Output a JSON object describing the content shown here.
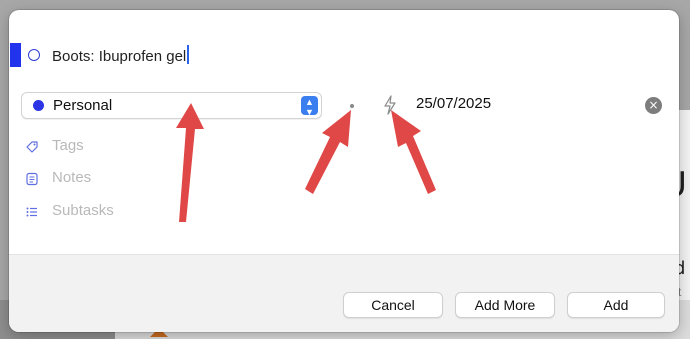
{
  "reminder": {
    "title": "Boots: Ibuprofen gel",
    "list_name": "Personal",
    "list_color": "#2b35e6",
    "due_date": "25/07/2025"
  },
  "fields": {
    "tags_placeholder": "Tags",
    "notes_placeholder": "Notes",
    "subtasks_placeholder": "Subtasks"
  },
  "buttons": {
    "cancel": "Cancel",
    "add_more": "Add More",
    "add": "Add"
  },
  "icons": {
    "status": "circle-check-icon",
    "list_stepper": "chevron-up-down-icon",
    "priority": "dot-icon",
    "deadline": "bolt-icon",
    "clear": "close-icon",
    "tags": "tag-icon",
    "notes": "notes-icon",
    "subtasks": "list-icon"
  },
  "colors": {
    "accent": "#3a7ef0",
    "annotation_arrow": "#e04848"
  }
}
